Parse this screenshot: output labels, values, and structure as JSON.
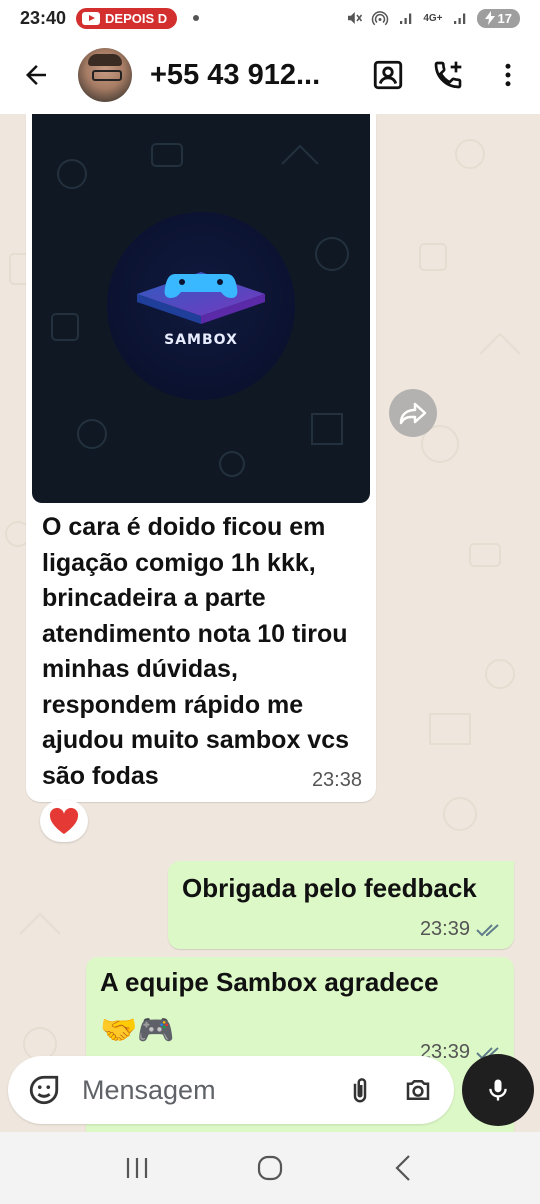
{
  "status_bar": {
    "time": "23:40",
    "notification_pill": "DEPOIS D",
    "network": "4G+",
    "battery": "17"
  },
  "header": {
    "contact_name": "+55 43 912...",
    "icons": [
      "back-arrow-icon",
      "contact-card-icon",
      "add-call-icon",
      "more-vert-icon"
    ]
  },
  "messages": {
    "incoming": {
      "image_logo_text": "SAMBOX",
      "text": "O cara é doido  ficou em ligação comigo 1h kkk, brincadeira a parte atendimento nota 10 tirou minhas dúvidas, respondem rápido  me ajudou muito sambox vcs são fodas",
      "time": "23:38",
      "reaction": "❤️"
    },
    "outgoing": [
      {
        "text": "Obrigada pelo feedback",
        "time": "23:39",
        "status": "read"
      },
      {
        "text": "A equipe Sambox agradece",
        "emojis": "🤝🎮",
        "time": "23:39",
        "status": "read"
      }
    ]
  },
  "input": {
    "placeholder": "Mensagem"
  },
  "colors": {
    "chat_background": "#efe7dd",
    "outgoing_bubble": "#dcf8c6",
    "incoming_bubble": "#ffffff",
    "reaction_heart": "#e53935"
  }
}
